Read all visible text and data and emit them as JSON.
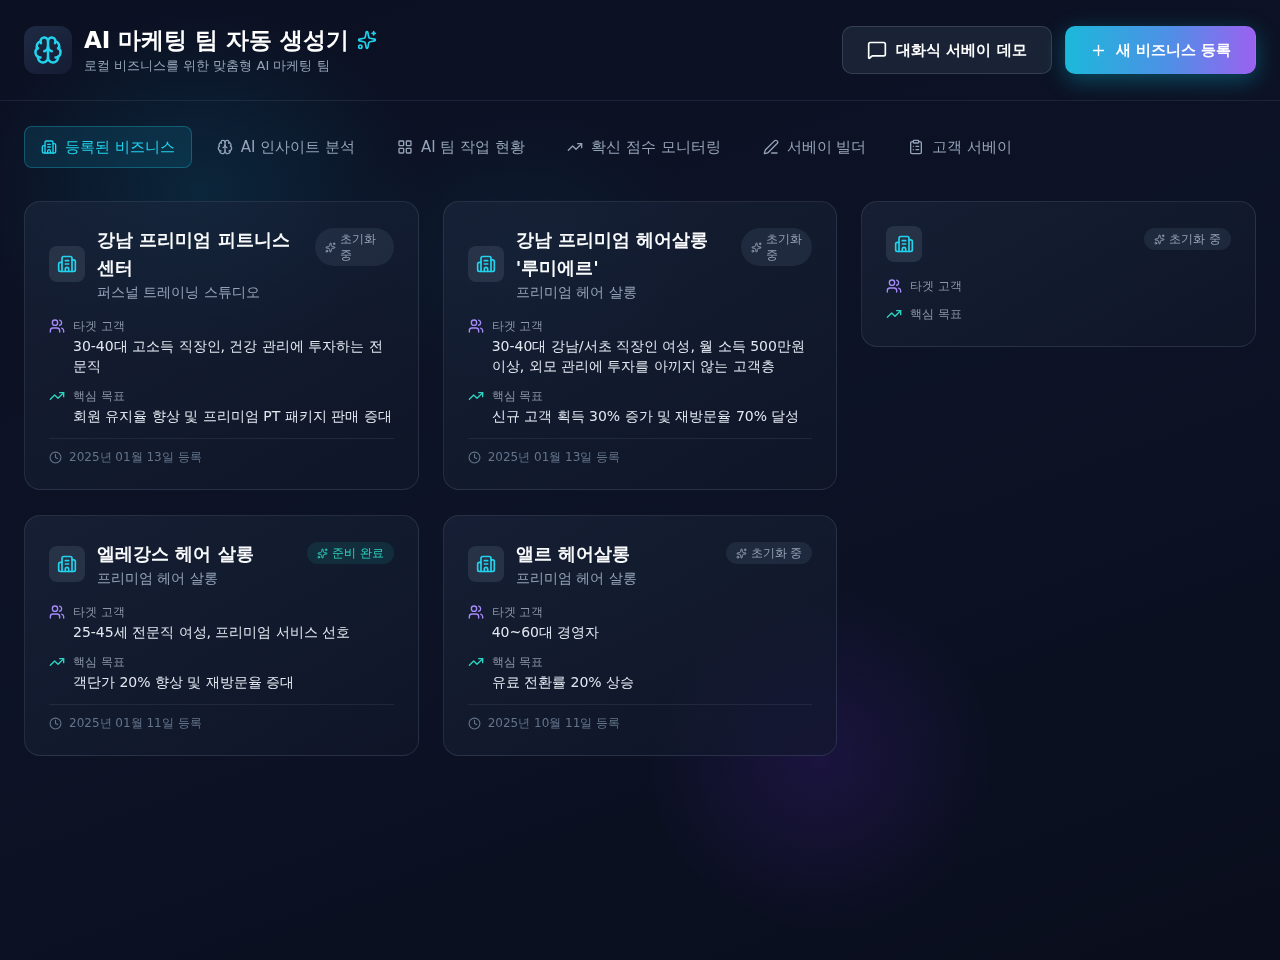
{
  "header": {
    "title": "AI 마케팅 팀 자동 생성기",
    "subtitle": "로컬 비즈니스를 위한 맞춤형 AI 마케팅 팀",
    "buttons": [
      {
        "kind": "secondary",
        "label": "대화식 서베이 데모"
      },
      {
        "kind": "primary",
        "label": "새 비즈니스 등록"
      }
    ]
  },
  "tabs": [
    {
      "label": "등록된 비즈니스",
      "selected": true
    },
    {
      "label": "AI 인사이트 분석",
      "selected": false
    },
    {
      "label": "AI 팀 작업 현황",
      "selected": false
    },
    {
      "label": "확신 점수 모니터링",
      "selected": false
    },
    {
      "label": "서베이 빌더",
      "selected": false
    },
    {
      "label": "고객 서베이",
      "selected": false
    }
  ],
  "businesses": [
    {
      "name": "강남 프리미엄 피트니스 센터",
      "category": "퍼스널 트레이닝 스튜디오",
      "status": {
        "label": "초기화 중",
        "ready": false
      },
      "details": [
        {
          "kind": "target",
          "label": "타겟 고객",
          "value": "30-40대 고소득 직장인, 건강 관리에 투자하는 전문직"
        },
        {
          "kind": "goal",
          "label": "핵심 목표",
          "value": "회원 유지율 향상 및 프리미엄 PT 패키지 판매 증대"
        }
      ],
      "date": "2025년 01월 13일 등록"
    },
    {
      "name": "강남 프리미엄 헤어살롱 '루미에르'",
      "category": "프리미엄 헤어 살롱",
      "status": {
        "label": "초기화 중",
        "ready": false
      },
      "details": [
        {
          "kind": "target",
          "label": "타겟 고객",
          "value": "30-40대 강남/서초 직장인 여성, 월 소득 500만원 이상, 외모 관리에 투자를 아끼지 않는 고객층"
        },
        {
          "kind": "goal",
          "label": "핵심 목표",
          "value": "신규 고객 획득 30% 증가 및 재방문율 70% 달성"
        }
      ],
      "date": "2025년 01월 13일 등록"
    },
    {
      "status": {
        "label": "초기화 중",
        "ready": false
      },
      "details": [
        {
          "kind": "target",
          "label": "타겟 고객"
        },
        {
          "kind": "goal",
          "label": "핵심 목표"
        }
      ]
    },
    {
      "name": "엘레강스 헤어 살롱",
      "category": "프리미엄 헤어 살롱",
      "status": {
        "label": "준비 완료",
        "ready": true
      },
      "details": [
        {
          "kind": "target",
          "label": "타겟 고객",
          "value": "25-45세 전문직 여성, 프리미엄 서비스 선호"
        },
        {
          "kind": "goal",
          "label": "핵심 목표",
          "value": "객단가 20% 향상 및 재방문율 증대"
        }
      ],
      "date": "2025년 01월 11일 등록"
    },
    {
      "name": "앨르 헤어살롱",
      "category": "프리미엄 헤어 살롱",
      "status": {
        "label": "초기화 중",
        "ready": false
      },
      "details": [
        {
          "kind": "target",
          "label": "타겟 고객",
          "value": "40~60대 경영자"
        },
        {
          "kind": "goal",
          "label": "핵심 목표",
          "value": "유료 전환률 20% 상승"
        }
      ],
      "date": "2025년 10월 11일 등록"
    }
  ]
}
